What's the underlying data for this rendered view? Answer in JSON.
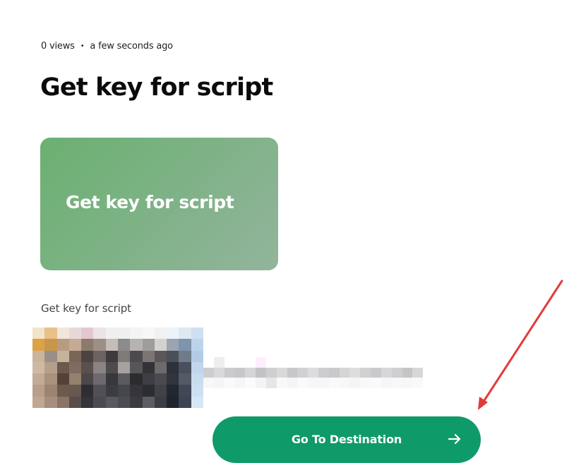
{
  "post": {
    "views": "0 views",
    "separator": "•",
    "time": "a few seconds ago",
    "title": "Get key for script",
    "card_title": "Get key for script",
    "description": "Get key for script"
  },
  "cta": {
    "label": "Go To Destination",
    "icon": "arrow-right-icon",
    "color": "#0f9a6a"
  },
  "annotation": {
    "color": "#e23b3b",
    "icon": "red-arrow-annotation"
  }
}
